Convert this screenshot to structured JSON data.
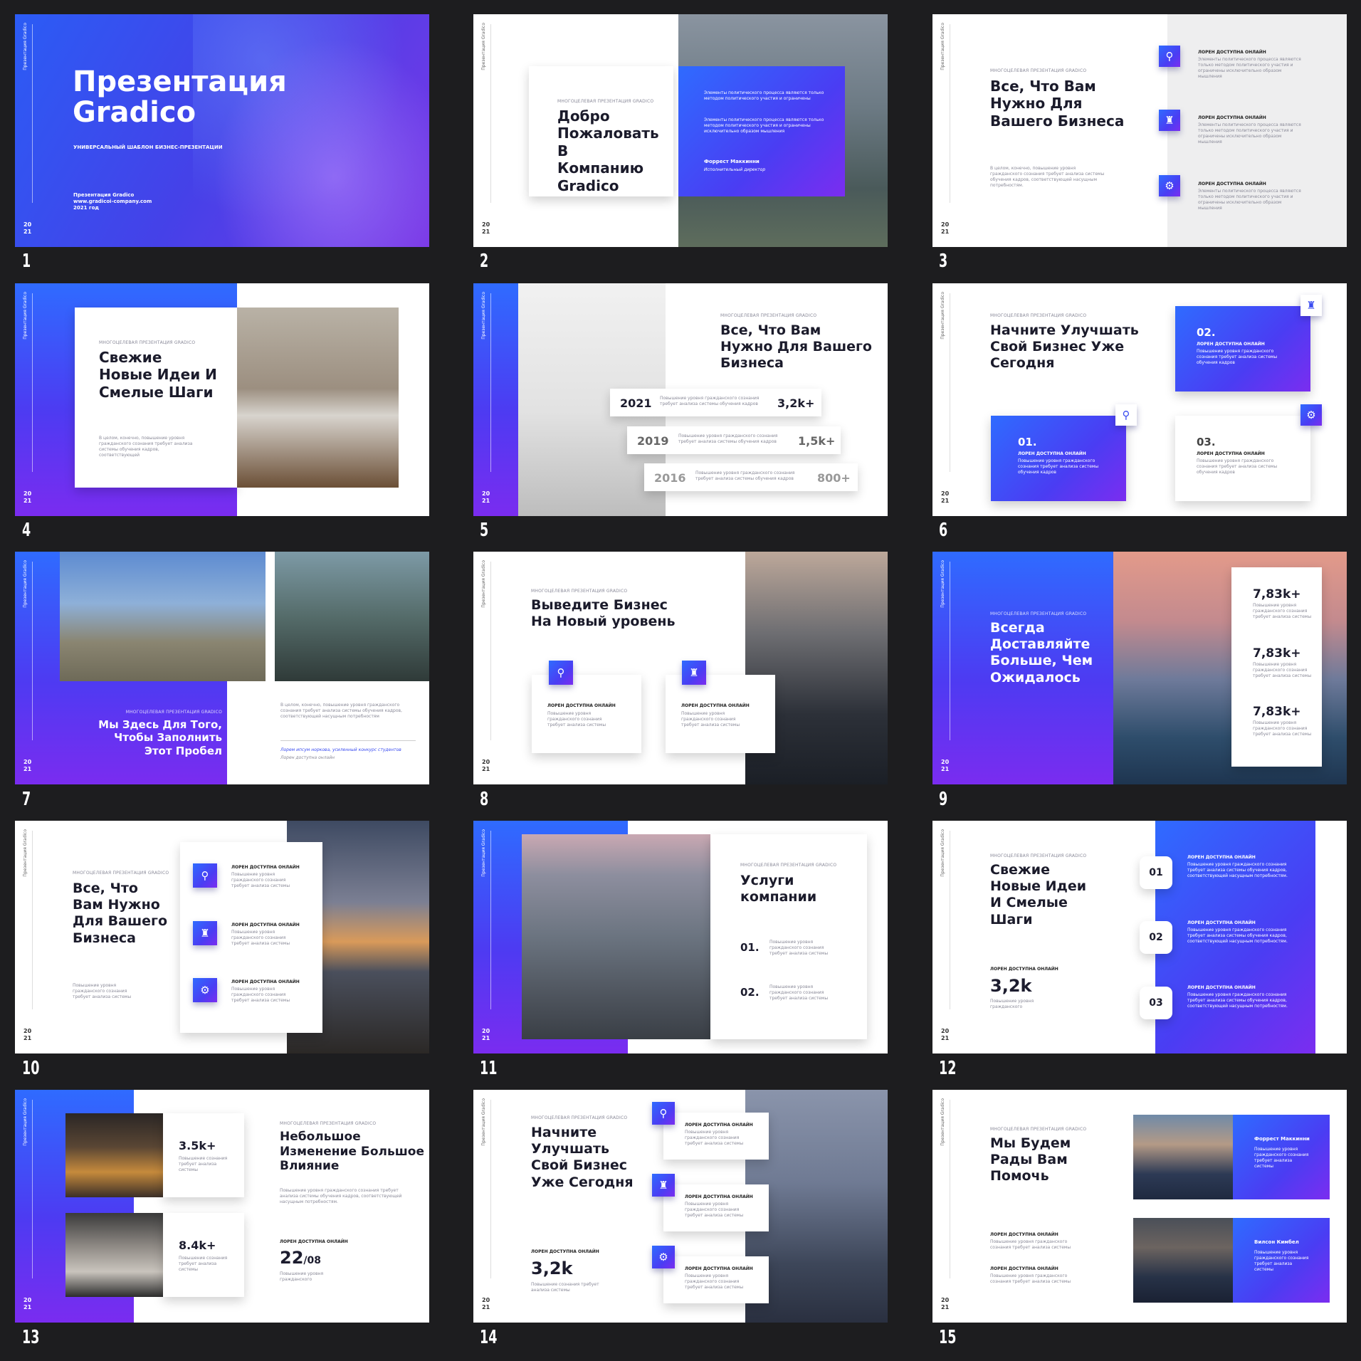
{
  "slide_numbers": [
    "1",
    "2",
    "3",
    "4",
    "5",
    "6",
    "7",
    "8",
    "9",
    "10",
    "11",
    "12",
    "13",
    "14",
    "15"
  ],
  "common": {
    "side_title": "Презентация Gradico",
    "year_top": "20",
    "year_bottom": "21",
    "eyebrow": "МНОГОЦЕЛЕВАЯ ПРЕЗЕНТАЦИЯ GRADICO",
    "label": "ЛОРЕН ДОСТУПНА ОНЛАЙН"
  },
  "s1": {
    "title_1": "Презентация",
    "title_2": "Gradico",
    "subtitle": "УНИВЕРСАЛЬНЫЙ ШАБЛОН БИЗНЕС-ПРЕЗЕНТАЦИИ",
    "info_1": "Презентация Gradico",
    "info_2": "www.gradicoi-company.com",
    "info_3": "2021 год"
  },
  "s2": {
    "title": "Добро Пожаловать В Компанию Gradico",
    "para_1": "Элементы политического процесса являются только методом политического участия и ограничены",
    "para_2": "Элементы политического процесса являются только методом политического участия и ограничены исключительно образом мышления",
    "name": "Форрест Маккинни",
    "role": "Исполнительный директор"
  },
  "s3": {
    "title": "Все, Что Вам Нужно Для Вашего Бизнеса",
    "body": "В целом, конечно, повышение уровня гражданского сознания требует анализа системы обучения кадров, соответствующей насущным потребностям.",
    "item_text": "Элементы политического процесса являются только методом политического участия и ограничены исключительно образом мышления"
  },
  "s4": {
    "title": "Свежие Новые Идеи И Смелые Шаги",
    "body": "В целом, конечно, повышение уровня гражданского сознания требует анализа системы обучения кадров, соответствующей"
  },
  "s5": {
    "title": "Все, Что Вам Нужно Для Вашего Бизнеса",
    "rows": [
      {
        "year": "2021",
        "text": "Повышение уровня гражданского сознания требует анализа системы обучения кадров",
        "value": "3,2k+"
      },
      {
        "year": "2019",
        "text": "Повышение уровня гражданского сознания требует анализа системы обучения кадров",
        "value": "1,5k+"
      },
      {
        "year": "2016",
        "text": "Повышение уровня гражданского сознания требует анализа системы обучения кадров",
        "value": "800+"
      }
    ]
  },
  "s6": {
    "title": "Начните Улучшать Свой Бизнес Уже Сегодня",
    "text": "Повышение уровня гражданского сознания требует анализа системы обучения кадров",
    "n1": "01.",
    "n2": "02.",
    "n3": "03."
  },
  "s7": {
    "title": "Мы Здесь Для Того, Чтобы Заполнить Этот Пробел",
    "body": "В целом, конечно, повышение уровня гражданского сознания требует анализа системы обучения кадров, соответствующей насущным потребностям",
    "quote": "Лорем ипсум норкова, усиленный конкурс студентов",
    "quote_sub": "Лорен доступна онлайн"
  },
  "s8": {
    "title": "Выведите Бизнес На Новый уровень",
    "text": "Повышение уровня гражданского сознания требует анализа системы"
  },
  "s9": {
    "title": "Всегда Доставляйте Больше, Чем Ожидалось",
    "stat": "7,83k+",
    "text": "Повышение уровня гражданского сознания требует анализа системы"
  },
  "s10": {
    "title": "Все, Что Вам Нужно Для Вашего Бизнеса",
    "body": "Повышение уровня гражданского сознания требует анализа системы",
    "text": "Повышение уровня гражданского сознания требует анализа системы"
  },
  "s11": {
    "title": "Услуги компании",
    "n1": "01.",
    "n2": "02.",
    "text": "Повышение уровня гражданского сознания требует анализа системы"
  },
  "s12": {
    "title": "Свежие Новые Идеи И Смелые Шаги",
    "stat": "3,2k",
    "stat_text": "Повышение уровня гражданского",
    "n1": "01",
    "n2": "02",
    "n3": "03",
    "text": "Повышение уровня гражданского сознания требует анализа системы обучения кадров, соответствующей насущным потребностям."
  },
  "s13": {
    "stat_1": "3.5k+",
    "stat_2": "8.4k+",
    "card_text": "Повышение сознания требует анализа системы",
    "title": "Небольшое Изменение Большое Влияние",
    "body": "Повышение уровня гражданского сознания требует анализа системы обучения кадров, соответствующей насущным потребностям.",
    "date_main": "22",
    "date_sub": "/08",
    "date_text": "Повышение уровня гражданского"
  },
  "s14": {
    "title": "Начните Улучшать Свой Бизнес Уже Сегодня",
    "stat": "3,2k",
    "stat_text": "Повышение сознания требует анализа системы",
    "text": "Повышение уровня гражданского сознания требует анализа системы"
  },
  "s15": {
    "title": "Мы Будем Рады Вам Помочь",
    "text_1": "Повышение уровня гражданского сознания требует анализа системы",
    "name_1": "Форрест Маккинни",
    "name_2": "Вилсон Кимбел",
    "person_text": "Повышение уровня гражданского сознания требует анализа системы"
  },
  "colors": {
    "background": "#1d1d1f",
    "accent_blue": "#2f6bff",
    "accent_violet": "#7a2cf0"
  },
  "icons": [
    "search-icon",
    "chess-icon",
    "gear-icon"
  ]
}
